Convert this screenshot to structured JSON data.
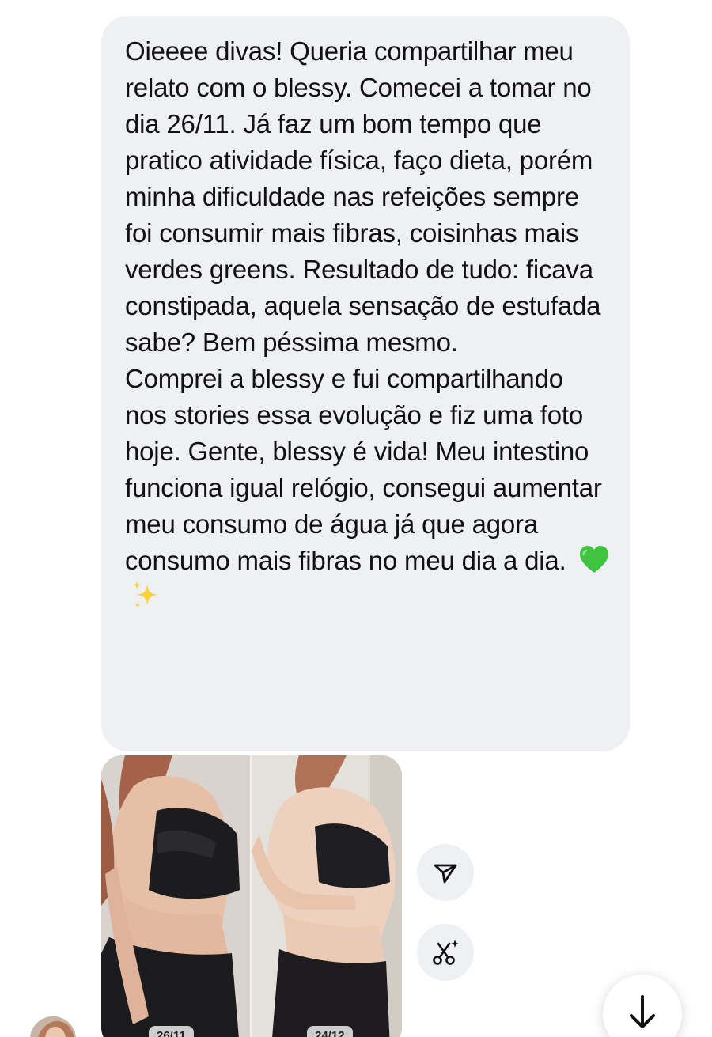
{
  "message": {
    "paragraph_1": "Oieeee divas! Queria compartilhar meu relato com o blessy. Comecei a tomar no dia 26/11. Já faz um bom tempo que pratico atividade física, faço dieta, porém minha dificuldade nas refeições sempre foi consumir mais fibras, coisinhas mais verdes greens. Resultado de tudo: ficava constipada, aquela sensação de estufada sabe? Bem péssima mesmo.",
    "paragraph_2": "Comprei a blessy e fui compartilhando nos stories essa evolução e fiz uma foto hoje. Gente, blessy é vida! Meu intestino funciona igual relógio, consegui aumentar meu consumo de água já que agora consumo mais fibras no meu dia a dia.",
    "emojis": [
      "green-heart",
      "sparkles"
    ],
    "bubble_color": "#eff0f4"
  },
  "photo": {
    "before_label": "26/11",
    "after_label": "24/12"
  },
  "actions": {
    "share_icon": "paper-plane-icon",
    "edit_icon": "scissors-sparkle-icon",
    "scroll_icon": "arrow-down-icon"
  }
}
